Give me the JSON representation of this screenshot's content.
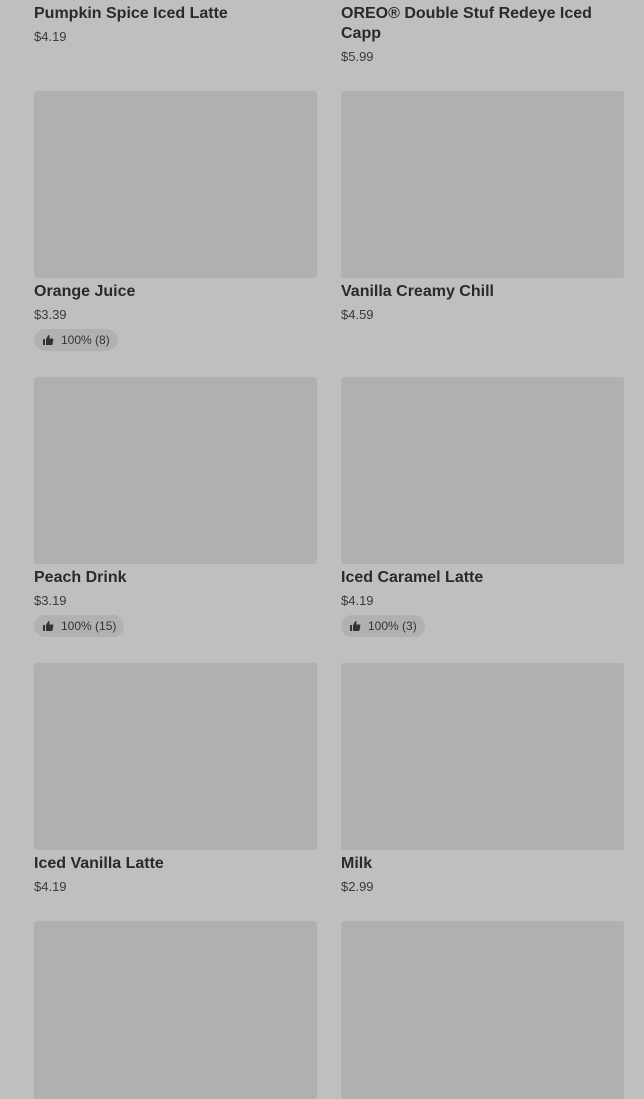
{
  "products": [
    {
      "name": "Pumpkin Spice Iced Latte",
      "price": "$4.19",
      "rating": null
    },
    {
      "name": "OREO® Double Stuf Redeye Iced Capp",
      "price": "$5.99",
      "rating": null
    },
    {
      "name": "Orange Juice",
      "price": "$3.39",
      "rating": "100% (8)"
    },
    {
      "name": "Vanilla Creamy Chill",
      "price": "$4.59",
      "rating": null
    },
    {
      "name": "Peach Drink",
      "price": "$3.19",
      "rating": "100% (15)"
    },
    {
      "name": "Iced Caramel Latte",
      "price": "$4.19",
      "rating": "100% (3)"
    },
    {
      "name": "Iced Vanilla Latte",
      "price": "$4.19",
      "rating": null
    },
    {
      "name": "Milk",
      "price": "$2.99",
      "rating": null
    }
  ],
  "icons": {
    "rating": "thumbs-up-icon"
  }
}
